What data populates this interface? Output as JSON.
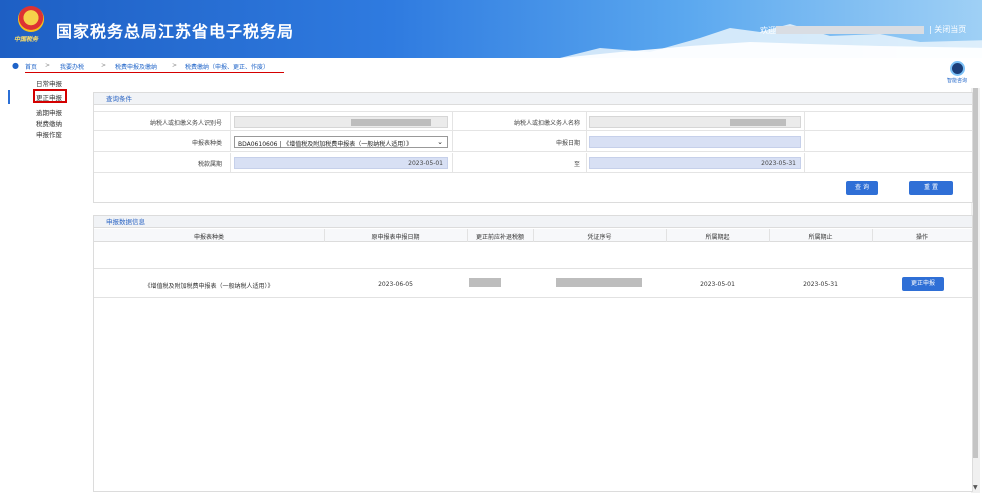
{
  "header": {
    "emblem_caption": "中国税务",
    "title": "国家税务总局江苏省电子税务局",
    "welcome": "欢迎",
    "close": "| 关闭当页"
  },
  "breadcrumb": {
    "items": [
      "首页",
      "我要办税",
      "税费申报及缴纳",
      "税费缴纳（申报、更正、作废）"
    ],
    "sep": ">"
  },
  "sidebar": {
    "items": [
      "日常申报",
      "更正申报",
      "逾期申报",
      "税费缴纳",
      "申报作废"
    ],
    "active_index": 1
  },
  "helper": {
    "label": "智能咨询"
  },
  "query": {
    "section_title": "查询条件",
    "taxpayer_id_label": "纳税人或扣缴义务人识别号",
    "taxpayer_name_label": "纳税人或扣缴义务人名称",
    "form_type_label": "申报表种类",
    "form_type_value": "BDA0610606 | 《增值税及附加税费申报表（一般纳税人适用）》",
    "declare_date_label": "申报日期",
    "period_label": "税款属期",
    "period_start": "2023-05-01",
    "to_label": "至",
    "period_end": "2023-05-31",
    "search_btn": "查 询",
    "reset_btn": "重 置"
  },
  "results": {
    "section_title": "申报数据信息",
    "columns": [
      "申报表种类",
      "原申报表申报日期",
      "更正前应补退税额",
      "凭证序号",
      "所属期起",
      "所属期止",
      "操作"
    ],
    "rows": [
      {
        "form_type": "《增值税及附加税费申报表（一般纳税人适用）》",
        "orig_date": "2023-06-05",
        "period_start": "2023-05-01",
        "period_end": "2023-05-31",
        "action": "更正申报"
      }
    ]
  }
}
